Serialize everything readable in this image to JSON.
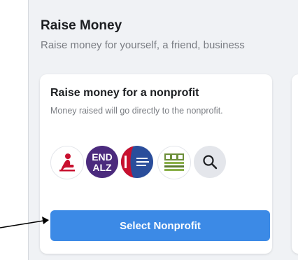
{
  "section": {
    "title": "Raise Money",
    "subtitle": "Raise money for yourself, a friend, business"
  },
  "nonprofit_card": {
    "title": "Raise money for a nonprofit",
    "description": "Money raised will go directly to the nonprofit.",
    "logos": [
      {
        "icon": "st-jude-logo-icon"
      },
      {
        "icon": "end-alz-logo-icon",
        "text_line1": "END",
        "text_line2": "ALZ"
      },
      {
        "icon": "american-cancer-society-logo-icon"
      },
      {
        "icon": "sick-kids-logo-icon"
      },
      {
        "icon": "search-icon"
      }
    ],
    "button_label": "Select Nonprofit"
  },
  "colors": {
    "button": "#3c8ae6",
    "end_alz_purple": "#4b2a7d",
    "acs_blue": "#2a4d9b",
    "acs_red": "#c8102e",
    "st_jude_red": "#c8102e"
  }
}
